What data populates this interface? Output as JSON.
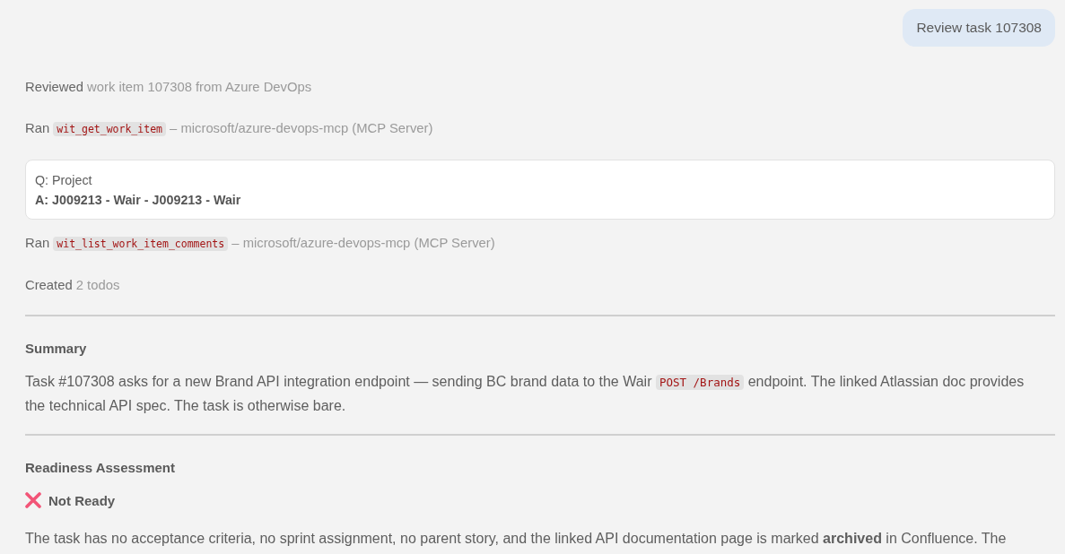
{
  "user_message": {
    "text": "Review task 107308"
  },
  "activity": [
    {
      "kind": "status",
      "verb": "Reviewed",
      "detail": "work item 107308 from Azure DevOps"
    },
    {
      "kind": "tool",
      "verb": "Ran",
      "tool": "wit_get_work_item",
      "source": "– microsoft/azure-devops-mcp (MCP Server)"
    },
    {
      "kind": "qa",
      "question": "Q: Project",
      "answer": "A: J009213 - Wair - J009213 - Wair"
    },
    {
      "kind": "tool",
      "verb": "Ran",
      "tool": "wit_list_work_item_comments",
      "source": "– microsoft/azure-devops-mcp (MCP Server)"
    },
    {
      "kind": "status",
      "verb": "Created",
      "detail": "2 todos"
    }
  ],
  "sections": [
    {
      "heading": "Summary",
      "blocks": [
        {
          "kind": "paragraph",
          "parts": [
            {
              "kind": "text",
              "text": "Task #107308 asks for a new Brand API integration endpoint — sending BC brand data to the Wair"
            },
            {
              "kind": "code",
              "text": "POST /Brands"
            },
            {
              "kind": "text",
              "text": "endpoint. The linked Atlassian doc provides the technical API spec. The task is otherwise bare."
            }
          ]
        }
      ]
    },
    {
      "heading": "Readiness Assessment",
      "blocks": [
        {
          "kind": "verdict",
          "label": "Not Ready",
          "ready": false
        },
        {
          "kind": "paragraph",
          "parts": [
            {
              "kind": "text",
              "text": "The task has no acceptance criteria, no sprint assignment, no parent story, and the linked API documentation page is marked **archived** in Confluence. The"
            }
          ]
        }
      ]
    }
  ]
}
